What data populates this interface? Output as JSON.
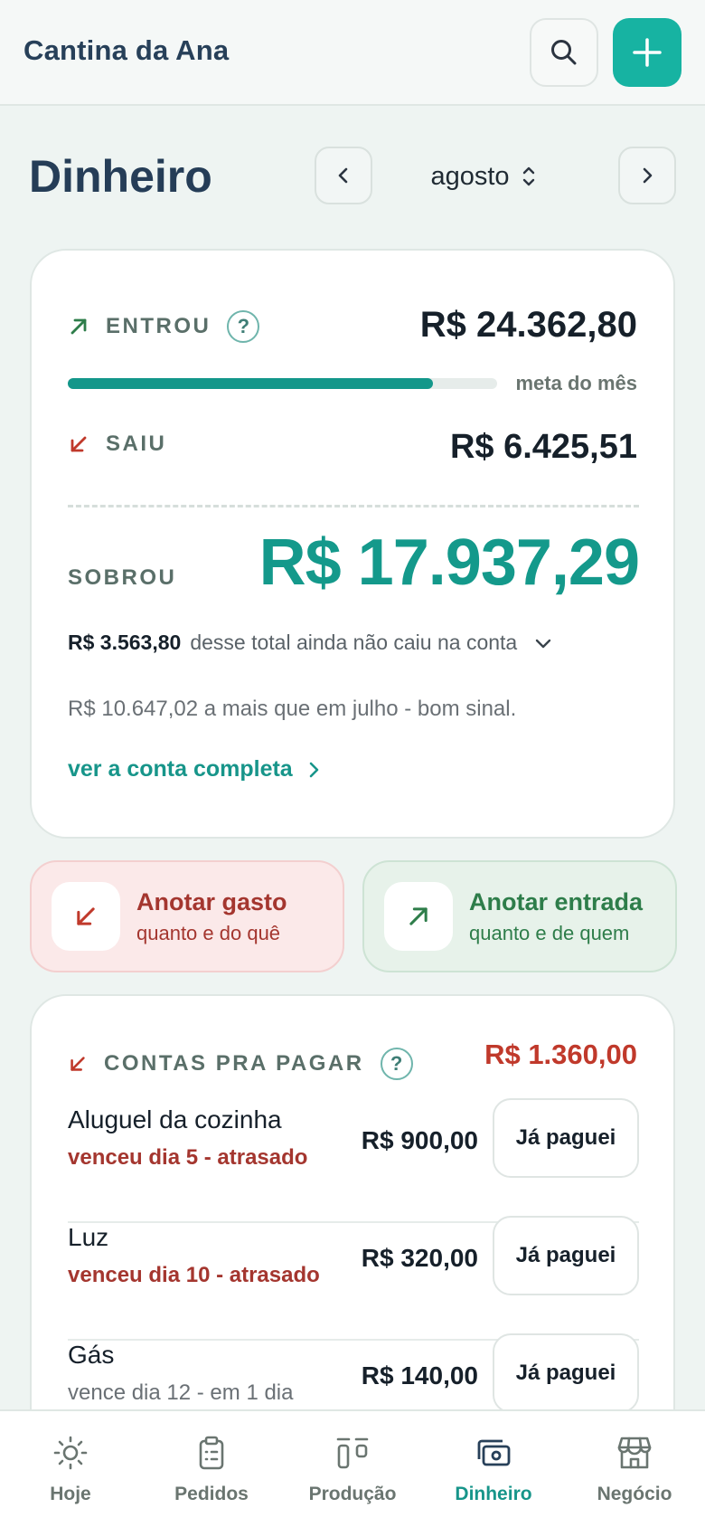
{
  "app": {
    "name": "Cantina da Ana"
  },
  "header": {
    "search_icon": "search-icon",
    "add_icon": "plus-icon"
  },
  "page": {
    "title": "Dinheiro"
  },
  "month": {
    "label": "agosto"
  },
  "summary": {
    "entrou_label": "ENTROU",
    "entrou_amount": "R$ 24.362,80",
    "help": "?",
    "goal_label": "meta do mês",
    "goal_progress": 0.85,
    "saiu_label": "SAIU",
    "saiu_amount": "R$ 6.425,51",
    "sobrou_label": "SOBROU",
    "sobrou_amount": "R$ 17.937,29",
    "pending_amount": "R$ 3.563,80",
    "pending_text": "desse total ainda não caiu na conta",
    "comparison": "R$ 10.647,02 a mais que em julho - bom sinal.",
    "full_link": "ver a conta completa"
  },
  "quick_actions": {
    "gasto": {
      "title": "Anotar gasto",
      "subtitle": "quanto e do quê"
    },
    "entrada": {
      "title": "Anotar entrada",
      "subtitle": "quanto e de quem"
    }
  },
  "bills": {
    "title": "CONTAS PRA PAGAR",
    "help": "?",
    "total": "R$ 1.360,00",
    "button_label": "Já paguei",
    "items": [
      {
        "name": "Aluguel da cozinha",
        "due": "venceu dia 5 - atrasado",
        "amount": "R$ 900,00"
      },
      {
        "name": "Luz",
        "due": "venceu dia 10 - atrasado",
        "amount": "R$ 320,00"
      },
      {
        "name": "Gás",
        "due": "vence dia 12 - em 1 dia",
        "amount": "R$ 140,00"
      }
    ]
  },
  "tabs": [
    {
      "label": "Hoje",
      "icon": "sun-icon"
    },
    {
      "label": "Pedidos",
      "icon": "clipboard-icon"
    },
    {
      "label": "Produção",
      "icon": "production-icon"
    },
    {
      "label": "Dinheiro",
      "icon": "cash-icon",
      "active": true
    },
    {
      "label": "Negócio",
      "icon": "store-icon"
    }
  ],
  "colors": {
    "accent": "#17b3a2",
    "positive": "#2e7d4a",
    "negative": "#c0392b",
    "title": "#253d57"
  }
}
